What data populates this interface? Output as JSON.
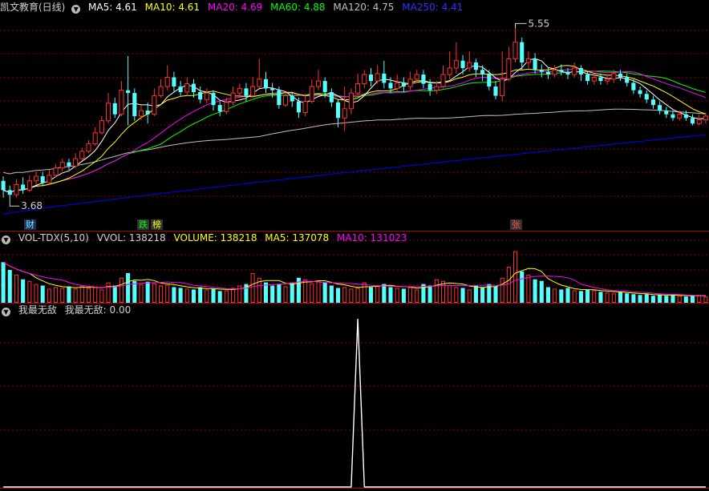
{
  "main_header": {
    "title": "凯文教育(日线)",
    "ma5": "MA5: 4.61",
    "ma10": "MA10: 4.61",
    "ma20": "MA20: 4.69",
    "ma60": "MA60: 4.88",
    "ma120": "MA120: 4.75",
    "ma250": "MA250: 4.41"
  },
  "vol_header": {
    "title": "VOL-TDX(5,10)",
    "vvol": "VVOL: 138218",
    "volume": "VOLUME: 138218",
    "ma5": "MA5: 137078",
    "ma10": "MA10: 131023"
  },
  "ind_header": {
    "title": "我最无敌",
    "value": "我最无敌: 0.00"
  },
  "markers": {
    "high_label": "5.55",
    "low_label": "3.68",
    "cai": "财",
    "die": "跌",
    "bang": "榜",
    "zhang": "张"
  },
  "colors": {
    "up": "#ff3232",
    "down": "#54ffff",
    "ma5": "#ffffff",
    "ma10": "#ffff00",
    "ma20": "#ff00ff",
    "ma60": "#00ff00",
    "ma120": "#c0c0c0",
    "ma250": "#0000ff",
    "grid": "#8b0000"
  },
  "chart_data": [
    {
      "type": "candlestick",
      "title": "凯文教育(日线)",
      "ylim": [
        3.5,
        5.7
      ],
      "annotations": [
        {
          "label": "5.55",
          "value": 5.55
        },
        {
          "label": "3.68",
          "value": 3.68
        }
      ],
      "bars": [
        [
          3.9,
          3.8,
          3.95,
          3.72
        ],
        [
          3.8,
          3.75,
          3.85,
          3.68
        ],
        [
          3.75,
          3.86,
          3.92,
          3.72
        ],
        [
          3.86,
          3.8,
          3.94,
          3.76
        ],
        [
          3.8,
          3.9,
          3.96,
          3.78
        ],
        [
          3.9,
          3.95,
          4.0,
          3.86
        ],
        [
          3.95,
          3.88,
          4.0,
          3.85
        ],
        [
          3.88,
          3.96,
          4.02,
          3.86
        ],
        [
          3.96,
          4.04,
          4.08,
          3.94
        ],
        [
          4.04,
          4.1,
          4.14,
          4.0
        ],
        [
          4.1,
          4.06,
          4.14,
          4.02
        ],
        [
          4.06,
          4.14,
          4.2,
          4.04
        ],
        [
          4.14,
          4.22,
          4.26,
          4.12
        ],
        [
          4.22,
          4.3,
          4.34,
          4.2
        ],
        [
          4.3,
          4.42,
          4.48,
          4.28
        ],
        [
          4.42,
          4.55,
          4.6,
          4.4
        ],
        [
          4.55,
          4.74,
          4.85,
          4.52
        ],
        [
          4.74,
          4.62,
          4.8,
          4.58
        ],
        [
          4.62,
          4.88,
          4.98,
          4.6
        ],
        [
          4.88,
          4.85,
          5.25,
          4.5
        ],
        [
          4.85,
          4.6,
          4.9,
          4.55
        ],
        [
          4.6,
          4.66,
          4.72,
          4.56
        ],
        [
          4.66,
          4.62,
          4.75,
          4.52
        ],
        [
          4.62,
          4.82,
          4.9,
          4.6
        ],
        [
          4.82,
          4.92,
          5.0,
          4.8
        ],
        [
          4.92,
          5.02,
          5.15,
          4.88
        ],
        [
          5.02,
          4.92,
          5.08,
          4.86
        ],
        [
          4.92,
          4.86,
          4.98,
          4.82
        ],
        [
          4.86,
          4.95,
          5.02,
          4.82
        ],
        [
          4.95,
          4.86,
          5.0,
          4.8
        ],
        [
          4.86,
          4.78,
          4.92,
          4.74
        ],
        [
          4.78,
          4.85,
          4.9,
          4.74
        ],
        [
          4.85,
          4.72,
          4.88,
          4.66
        ],
        [
          4.72,
          4.65,
          4.76,
          4.6
        ],
        [
          4.65,
          4.75,
          4.8,
          4.62
        ],
        [
          4.75,
          4.85,
          4.92,
          4.72
        ],
        [
          4.85,
          4.9,
          4.95,
          4.8
        ],
        [
          4.9,
          4.82,
          4.96,
          4.76
        ],
        [
          4.82,
          4.92,
          5.02,
          4.8
        ],
        [
          4.92,
          5.0,
          5.22,
          4.9
        ],
        [
          5.0,
          4.9,
          5.08,
          4.85
        ],
        [
          4.9,
          4.88,
          4.96,
          4.8
        ],
        [
          4.88,
          4.72,
          4.92,
          4.68
        ],
        [
          4.72,
          4.82,
          4.86,
          4.7
        ],
        [
          4.82,
          4.76,
          4.86,
          4.7
        ],
        [
          4.76,
          4.64,
          4.8,
          4.58
        ],
        [
          4.64,
          4.76,
          4.84,
          4.6
        ],
        [
          4.76,
          4.92,
          5.0,
          4.74
        ],
        [
          4.92,
          4.98,
          5.1,
          4.88
        ],
        [
          4.98,
          4.86,
          5.02,
          4.8
        ],
        [
          4.86,
          4.75,
          4.9,
          4.7
        ],
        [
          4.75,
          4.58,
          4.78,
          4.48
        ],
        [
          4.58,
          4.68,
          4.92,
          4.44
        ],
        [
          4.68,
          4.85,
          4.9,
          4.62
        ],
        [
          4.85,
          4.95,
          5.06,
          4.82
        ],
        [
          4.95,
          5.05,
          5.1,
          4.9
        ],
        [
          5.05,
          4.98,
          5.12,
          4.92
        ],
        [
          4.98,
          5.06,
          5.15,
          4.95
        ],
        [
          5.06,
          4.96,
          5.2,
          4.9
        ],
        [
          4.96,
          4.9,
          5.02,
          4.85
        ],
        [
          4.9,
          4.96,
          5.05,
          4.86
        ],
        [
          4.96,
          4.92,
          5.02,
          4.86
        ],
        [
          4.92,
          5.0,
          5.08,
          4.88
        ],
        [
          5.0,
          5.05,
          5.1,
          4.96
        ],
        [
          5.05,
          4.95,
          5.1,
          4.9
        ],
        [
          4.95,
          4.88,
          5.0,
          4.82
        ],
        [
          4.88,
          4.92,
          4.98,
          4.84
        ],
        [
          4.92,
          5.05,
          5.15,
          4.9
        ],
        [
          5.05,
          5.12,
          5.3,
          5.0
        ],
        [
          5.12,
          5.2,
          5.4,
          5.06
        ],
        [
          5.2,
          5.12,
          5.26,
          5.05
        ],
        [
          5.12,
          5.18,
          5.3,
          5.08
        ],
        [
          5.18,
          5.1,
          5.22,
          5.02
        ],
        [
          5.1,
          5.05,
          5.15,
          4.98
        ],
        [
          5.05,
          4.92,
          5.1,
          4.88
        ],
        [
          4.92,
          4.82,
          4.98,
          4.78
        ],
        [
          4.82,
          5.0,
          5.3,
          4.76
        ],
        [
          5.0,
          5.22,
          5.35,
          4.98
        ],
        [
          5.22,
          5.4,
          5.55,
          5.18
        ],
        [
          5.4,
          5.18,
          5.45,
          5.1
        ],
        [
          5.18,
          5.22,
          5.3,
          5.12
        ],
        [
          5.22,
          5.1,
          5.28,
          5.06
        ],
        [
          5.1,
          5.08,
          5.16,
          5.02
        ],
        [
          5.08,
          5.05,
          5.12,
          5.0
        ],
        [
          5.05,
          5.1,
          5.15,
          5.02
        ],
        [
          5.1,
          5.08,
          5.16,
          5.04
        ],
        [
          5.08,
          5.05,
          5.12,
          5.0
        ],
        [
          5.05,
          5.12,
          5.18,
          5.02
        ],
        [
          5.12,
          5.05,
          5.15,
          4.98
        ],
        [
          5.05,
          4.98,
          5.08,
          4.94
        ],
        [
          4.98,
          5.02,
          5.06,
          4.94
        ],
        [
          5.02,
          4.98,
          5.06,
          4.94
        ],
        [
          4.98,
          5.0,
          5.04,
          4.94
        ],
        [
          5.0,
          5.06,
          5.1,
          4.96
        ],
        [
          5.06,
          5.02,
          5.1,
          4.98
        ],
        [
          5.02,
          4.96,
          5.06,
          4.92
        ],
        [
          4.96,
          4.88,
          5.0,
          4.84
        ],
        [
          4.88,
          4.84,
          4.92,
          4.8
        ],
        [
          4.84,
          4.78,
          4.88,
          4.74
        ],
        [
          4.78,
          4.72,
          4.82,
          4.68
        ],
        [
          4.72,
          4.66,
          4.76,
          4.62
        ],
        [
          4.66,
          4.62,
          4.7,
          4.58
        ],
        [
          4.62,
          4.58,
          4.66,
          4.55
        ],
        [
          4.58,
          4.62,
          4.66,
          4.55
        ],
        [
          4.62,
          4.58,
          4.66,
          4.55
        ],
        [
          4.58,
          4.52,
          4.62,
          4.5
        ],
        [
          4.52,
          4.56,
          4.62,
          4.5
        ],
        [
          4.56,
          4.6,
          4.64,
          4.52
        ]
      ]
    },
    {
      "type": "bar",
      "title": "VOL-TDX(5,10)",
      "ylim": [
        0,
        400000
      ],
      "values": [
        260000,
        210000,
        180000,
        150000,
        140000,
        120000,
        110000,
        90000,
        100000,
        95000,
        105000,
        90000,
        110000,
        95000,
        100000,
        85000,
        130000,
        110000,
        160000,
        190000,
        140000,
        120000,
        135000,
        125000,
        110000,
        115000,
        100000,
        95000,
        90000,
        85000,
        100000,
        85000,
        90000,
        75000,
        80000,
        95000,
        110000,
        120000,
        190000,
        160000,
        130000,
        110000,
        120000,
        105000,
        130000,
        160000,
        150000,
        125000,
        140000,
        130000,
        110000,
        95000,
        100000,
        90000,
        95000,
        130000,
        100000,
        110000,
        120000,
        100000,
        95000,
        90000,
        100000,
        85000,
        120000,
        110000,
        150000,
        140000,
        115000,
        100000,
        95000,
        85000,
        110000,
        100000,
        120000,
        105000,
        160000,
        230000,
        330000,
        200000,
        180000,
        150000,
        140000,
        100000,
        90000,
        85000,
        95000,
        80000,
        75000,
        85000,
        80000,
        70000,
        65000,
        60000,
        70000,
        60000,
        55000,
        50000,
        55000,
        45000,
        50000,
        45000,
        50000,
        45000,
        40000,
        45000,
        50000,
        40000
      ]
    },
    {
      "type": "line",
      "title": "我最无敌",
      "ylim": [
        0,
        1
      ],
      "x_index": [
        0,
        53,
        54,
        55,
        107
      ],
      "values": [
        0,
        0,
        1,
        0,
        0
      ]
    }
  ]
}
